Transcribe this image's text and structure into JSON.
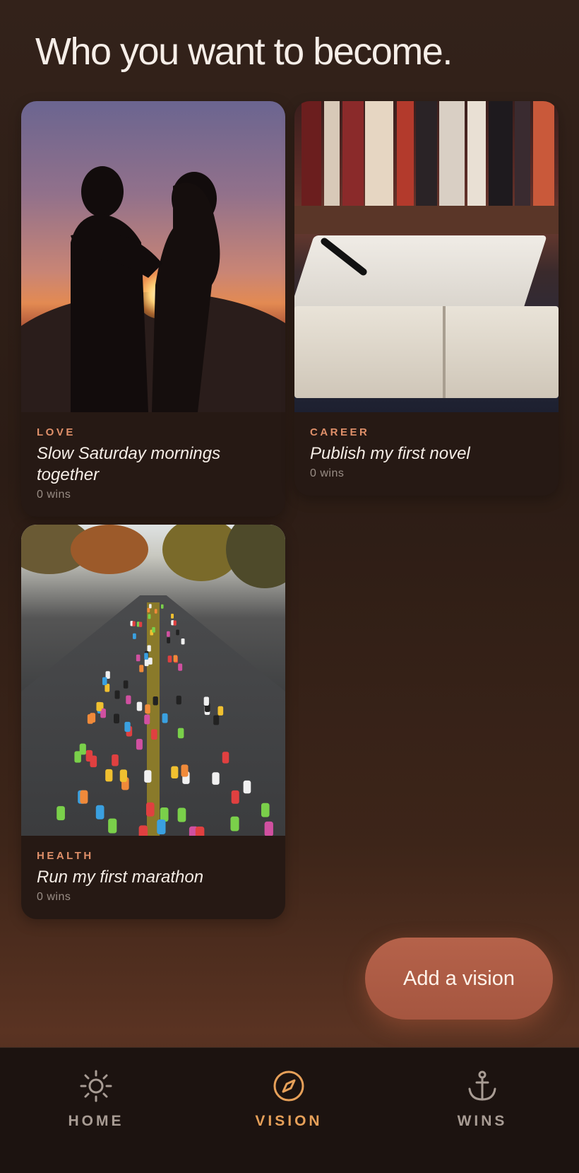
{
  "header": {
    "title": "Who you want to become."
  },
  "visions": [
    {
      "category": "LOVE",
      "goal": "Slow Saturday mornings together",
      "wins": "0 wins"
    },
    {
      "category": "CAREER",
      "goal": "Publish my first novel",
      "wins": "0 wins"
    },
    {
      "category": "HEALTH",
      "goal": "Run my first marathon",
      "wins": "0 wins"
    }
  ],
  "actions": {
    "add_vision": "Add a vision"
  },
  "tabbar": {
    "items": [
      {
        "label": "HOME",
        "icon": "sun-icon",
        "active": false
      },
      {
        "label": "VISION",
        "icon": "compass-icon",
        "active": true
      },
      {
        "label": "WINS",
        "icon": "anchor-icon",
        "active": false
      }
    ]
  },
  "colors": {
    "accent": "#e0906a",
    "active_tab": "#e6a059",
    "inactive_tab": "#a89c94"
  }
}
